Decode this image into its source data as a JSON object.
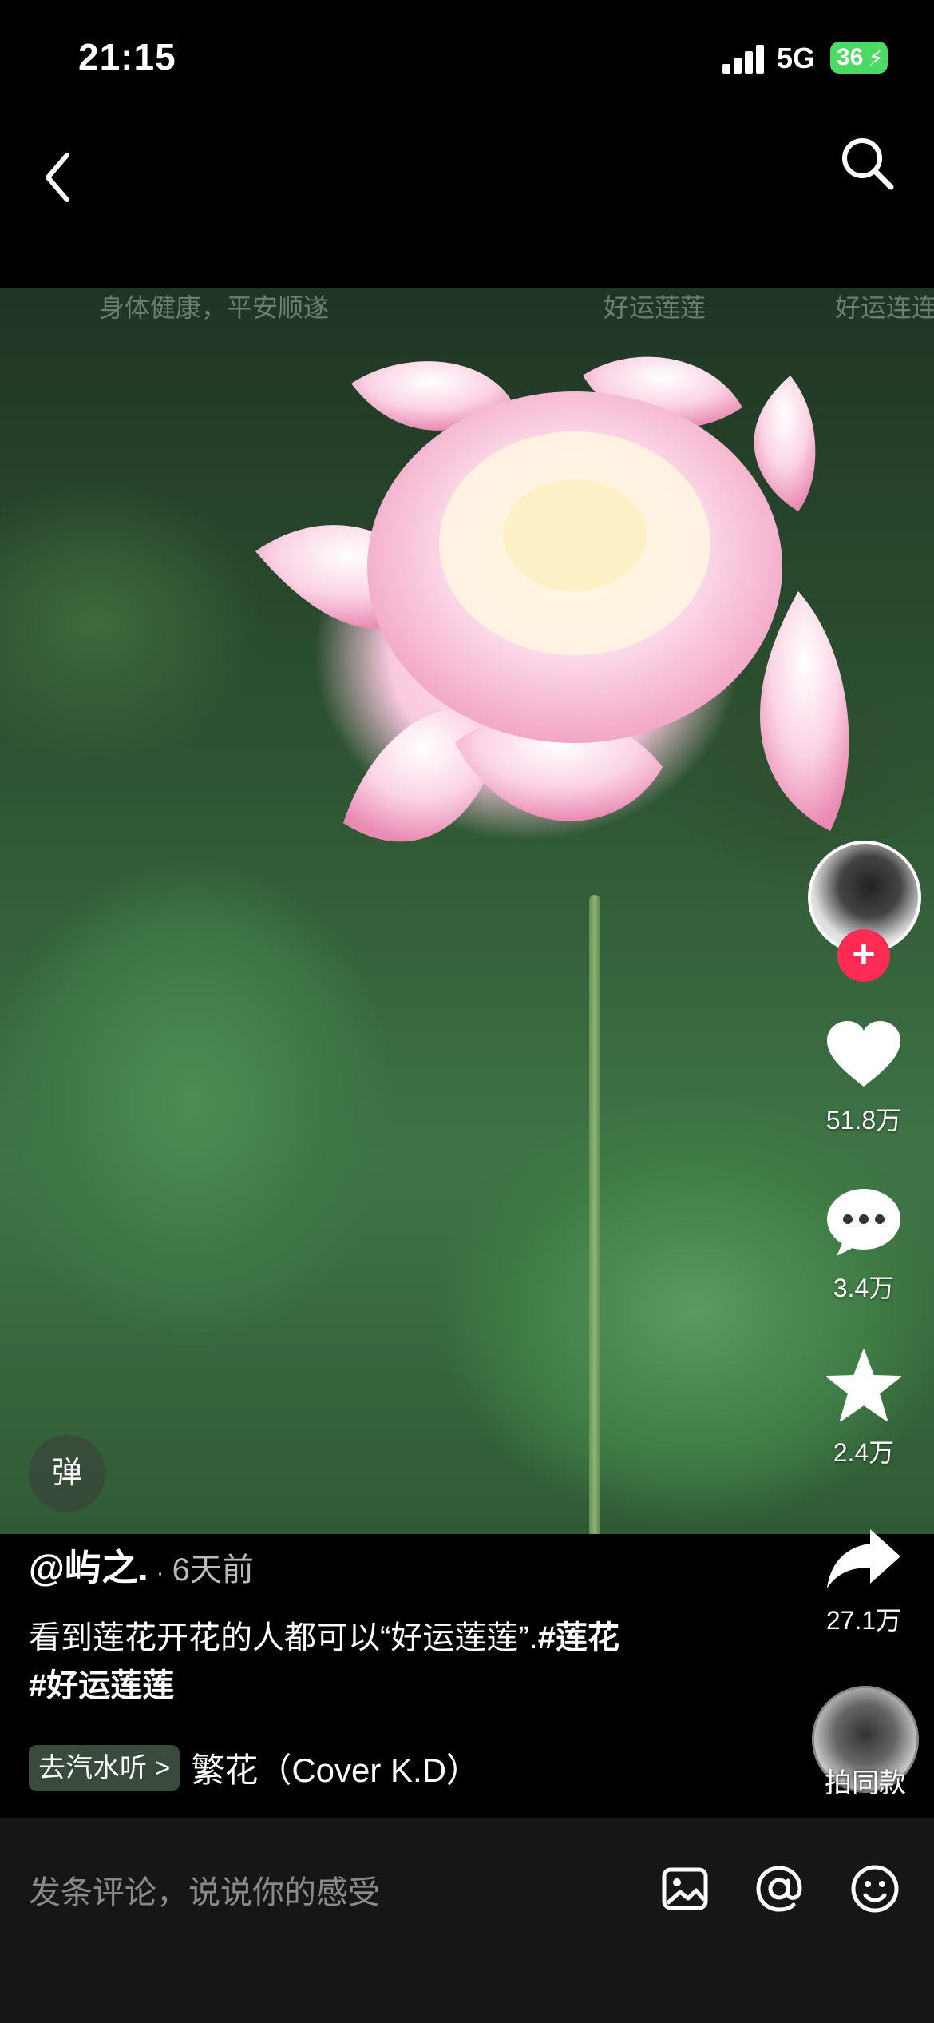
{
  "status_bar": {
    "time": "21:15",
    "network": "5G",
    "battery": "36"
  },
  "nav": {
    "back_icon": "chevron-left-icon",
    "search_icon": "search-icon"
  },
  "video": {
    "danmaku": [
      "身体健康，平安顺遂",
      "好运莲莲",
      "好运连连"
    ],
    "danmaku_toggle": "弹"
  },
  "rail": {
    "likes": "51.8万",
    "comments": "3.4万",
    "favorites": "2.4万",
    "shares": "27.1万",
    "follow_symbol": "+"
  },
  "post": {
    "author": "@屿之.",
    "separator": "·",
    "time_ago": "6天前",
    "caption_text": "看到莲花开花的人都可以“好运莲莲”.",
    "tags": [
      "#莲花",
      "#好运莲莲"
    ]
  },
  "music": {
    "chip_label": "去汽水听 >",
    "title": "繁花（Cover K.D）"
  },
  "same_style": {
    "label": "拍同款"
  },
  "comment_bar": {
    "placeholder": "发条评论，说说你的感受",
    "icons": [
      "image-icon",
      "at-icon",
      "emoji-icon"
    ]
  },
  "colors": {
    "accent": "#fe2c55",
    "background": "#000000",
    "battery": "#4cd964"
  }
}
